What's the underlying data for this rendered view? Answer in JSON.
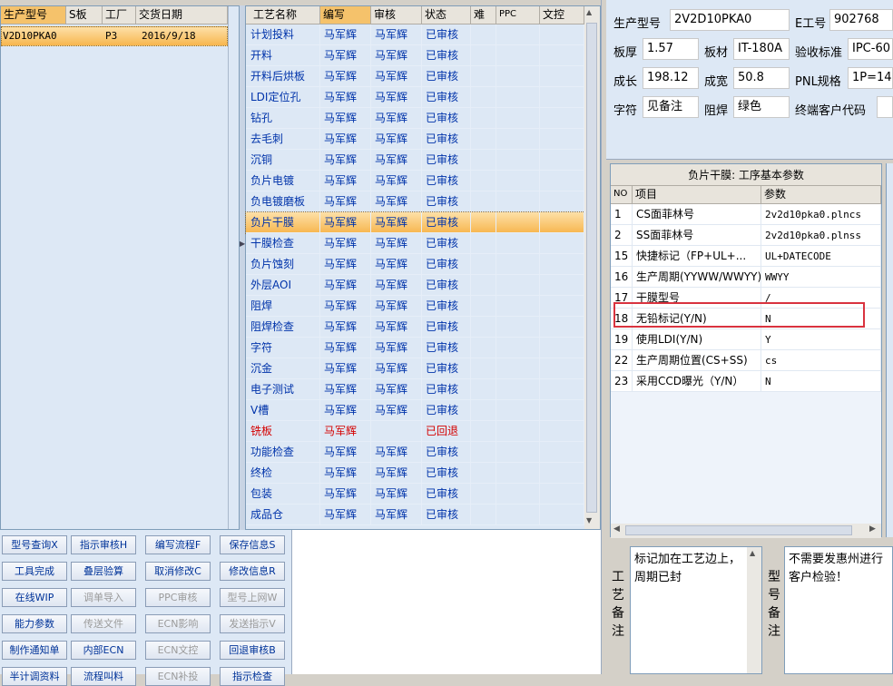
{
  "left_grid": {
    "headers": [
      "生产型号",
      "S板",
      "工厂",
      "交货日期"
    ],
    "rows": [
      [
        "V2D10PKA0",
        "",
        "P3",
        "2016/9/18"
      ]
    ]
  },
  "process_grid": {
    "headers": [
      "工艺名称",
      "编写",
      "审核",
      "状态",
      "难",
      "PPC",
      "文控"
    ],
    "rows": [
      [
        "计划投料",
        "马军辉",
        "马军辉",
        "已审核"
      ],
      [
        "开料",
        "马军辉",
        "马军辉",
        "已审核"
      ],
      [
        "开料后烘板",
        "马军辉",
        "马军辉",
        "已审核"
      ],
      [
        "LDI定位孔",
        "马军辉",
        "马军辉",
        "已审核"
      ],
      [
        "钻孔",
        "马军辉",
        "马军辉",
        "已审核"
      ],
      [
        "去毛刺",
        "马军辉",
        "马军辉",
        "已审核"
      ],
      [
        "沉铜",
        "马军辉",
        "马军辉",
        "已审核"
      ],
      [
        "负片电镀",
        "马军辉",
        "马军辉",
        "已审核"
      ],
      [
        "负电镀磨板",
        "马军辉",
        "马军辉",
        "已审核"
      ],
      [
        "负片干膜",
        "马军辉",
        "马军辉",
        "已审核"
      ],
      [
        "干膜检查",
        "马军辉",
        "马军辉",
        "已审核"
      ],
      [
        "负片蚀刻",
        "马军辉",
        "马军辉",
        "已审核"
      ],
      [
        "外层AOI",
        "马军辉",
        "马军辉",
        "已审核"
      ],
      [
        "阻焊",
        "马军辉",
        "马军辉",
        "已审核"
      ],
      [
        "阻焊检查",
        "马军辉",
        "马军辉",
        "已审核"
      ],
      [
        "字符",
        "马军辉",
        "马军辉",
        "已审核"
      ],
      [
        "沉金",
        "马军辉",
        "马军辉",
        "已审核"
      ],
      [
        "电子测试",
        "马军辉",
        "马军辉",
        "已审核"
      ],
      [
        "V槽",
        "马军辉",
        "马军辉",
        "已审核"
      ],
      [
        "铣板",
        "马军辉",
        "",
        "已回退"
      ],
      [
        "功能检查",
        "马军辉",
        "马军辉",
        "已审核"
      ],
      [
        "终检",
        "马军辉",
        "马军辉",
        "已审核"
      ],
      [
        "包装",
        "马军辉",
        "马军辉",
        "已审核"
      ],
      [
        "成品仓",
        "马军辉",
        "马军辉",
        "已审核"
      ]
    ]
  },
  "buttons": [
    [
      "型号查询X",
      "指示审核H",
      "编写流程F",
      "保存信息S"
    ],
    [
      "工具完成",
      "叠层验算",
      "取消修改C",
      "修改信息R"
    ],
    [
      "在线WIP",
      "调单导入",
      "PPC审核",
      "型号上网W"
    ],
    [
      "能力参数",
      "传送文件",
      "ECN影响",
      "发送指示V"
    ],
    [
      "制作通知单",
      "内部ECN",
      "ECN文控",
      "回退审核B"
    ],
    [
      "半计调资料",
      "流程叫料",
      "ECN补投",
      "指示检查"
    ]
  ],
  "info": {
    "model_label": "生产型号",
    "model_value": "2V2D10PKA0",
    "e_label": "E工号",
    "e_value": "902768",
    "thick_label": "板厚",
    "thick_value": "1.57",
    "mat_label": "板材",
    "mat_value": "IT-180A",
    "std_label": "验收标准",
    "std_value": "IPC-60",
    "len_label": "成长",
    "len_value": "198.12",
    "wid_label": "成宽",
    "wid_value": "50.8",
    "pnl_label": "PNL规格",
    "pnl_value": "1P=14",
    "char_label": "字符",
    "char_value": "见备注",
    "solder_label": "阻焊",
    "solder_value": "绿色",
    "cust_label": "终端客户代码"
  },
  "params": {
    "title": "负片干膜: 工序基本参数",
    "headers": [
      "NO",
      "项目",
      "参数"
    ],
    "rows": [
      [
        "1",
        "CS面菲林号",
        "2v2d10pka0.plncs"
      ],
      [
        "2",
        "SS面菲林号",
        "2v2d10pka0.plnss"
      ],
      [
        "15",
        "快捷标记（FP+UL+...",
        "UL+DATECODE"
      ],
      [
        "16",
        "生产周期(YYWW/WWYY)",
        "WWYY"
      ],
      [
        "17",
        "干膜型号",
        "/"
      ],
      [
        "18",
        "无铅标记(Y/N)",
        "N"
      ],
      [
        "19",
        "使用LDI(Y/N)",
        "Y"
      ],
      [
        "22",
        "生产周期位置(CS+SS)",
        "cs"
      ],
      [
        "23",
        "采用CCD曝光（Y/N）",
        "N"
      ]
    ]
  },
  "remarks": {
    "proc_label": "工艺备注",
    "proc_text": "标记加在工艺边上，周期已封",
    "model_label": "型号备注",
    "model_text": "不需要发惠州进行客户检验！"
  },
  "colors": {
    "selected_row": "#f7b64e",
    "returned_status": "#d40000",
    "highlight_box": "#d9333f"
  }
}
